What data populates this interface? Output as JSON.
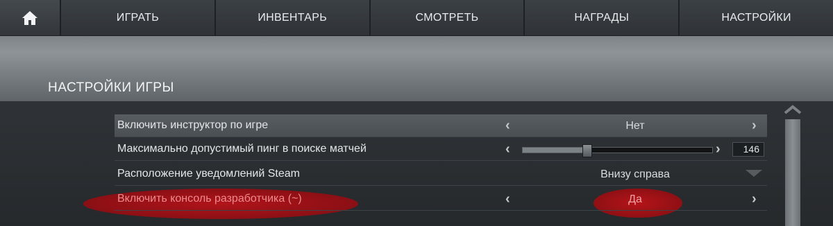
{
  "nav": {
    "home_icon": "home-icon",
    "items": [
      "ИГРАТЬ",
      "ИНВЕНТАРЬ",
      "СМОТРЕТЬ",
      "НАГРАДЫ",
      "НАСТРОЙКИ"
    ]
  },
  "section": {
    "title": "НАСТРОЙКИ ИГРЫ"
  },
  "settings": [
    {
      "label": "Включить инструктор по игре",
      "value": "Нет"
    },
    {
      "label": "Максимально допустимый пинг в поиске матчей",
      "value": "146",
      "slider_fraction": 0.34
    },
    {
      "label": "Расположение уведомлений Steam",
      "value": "Внизу справа"
    },
    {
      "label": "Включить консоль разработчика (~)",
      "value": "Да"
    }
  ],
  "icons": {
    "arrow_left": "‹",
    "arrow_right": "›"
  },
  "colors": {
    "highlight": "#b0141a",
    "highlight_text": "#ee8a8d"
  }
}
